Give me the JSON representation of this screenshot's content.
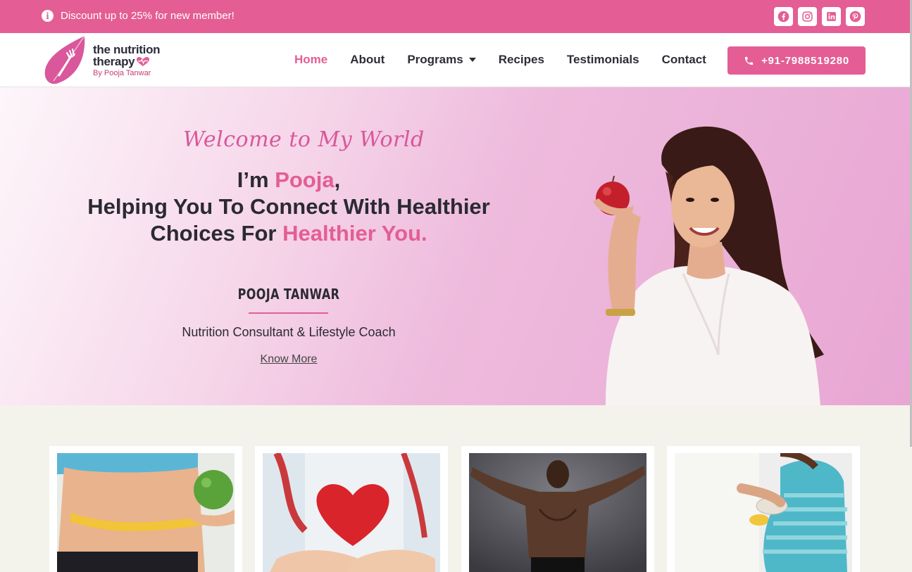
{
  "topbar": {
    "promo_text": "Discount up to 25% for new member!",
    "promo_icon": "info-icon",
    "socials": [
      {
        "name": "facebook-icon"
      },
      {
        "name": "instagram-icon"
      },
      {
        "name": "linkedin-icon"
      },
      {
        "name": "pinterest-icon"
      }
    ]
  },
  "header": {
    "logo": {
      "line1": "the nutrition",
      "line2": "therapy",
      "byline": "By Pooja Tanwar"
    },
    "nav": [
      {
        "label": "Home",
        "active": true
      },
      {
        "label": "About",
        "active": false
      },
      {
        "label": "Programs",
        "active": false,
        "has_dropdown": true
      },
      {
        "label": "Recipes",
        "active": false
      },
      {
        "label": "Testimonials",
        "active": false
      },
      {
        "label": "Contact",
        "active": false
      }
    ],
    "phone_label": "+91-7988519280"
  },
  "hero": {
    "welcome": "Welcome to My World",
    "headline_pre": "I’m ",
    "headline_name": "Pooja",
    "headline_comma": ",",
    "headline_line2": "Helping You To Connect With Healthier",
    "headline_line3_pre": "Choices For ",
    "headline_line3_accent": "Healthier You.",
    "person_name": "POOJA TANWAR",
    "role": "Nutrition Consultant & Lifestyle Coach",
    "cta": "Know More"
  },
  "colors": {
    "brand_pink": "#e45d94",
    "dark_text": "#2a2a33",
    "page_bg": "#f3f3ec"
  }
}
